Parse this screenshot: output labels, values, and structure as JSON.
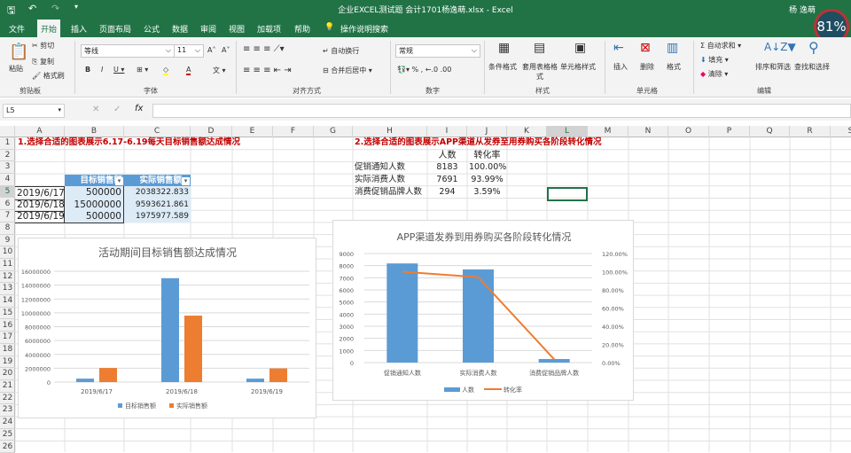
{
  "window": {
    "title": "企业EXCEL测试题 会计1701杨逸萌.xlsx - Excel",
    "user": "杨 逸萌",
    "badge": "81%"
  },
  "tabs": [
    "文件",
    "开始",
    "插入",
    "页面布局",
    "公式",
    "数据",
    "审阅",
    "视图",
    "加载项",
    "帮助",
    "操作说明搜索"
  ],
  "ribbon": {
    "clipboard": {
      "paste": "粘贴",
      "cut": "剪切",
      "copy": "复制",
      "painter": "格式刷",
      "group": "剪贴板"
    },
    "font": {
      "name": "等线",
      "size": "11",
      "group": "字体"
    },
    "align": {
      "wrap": "自动换行",
      "merge": "合并后居中",
      "group": "对齐方式"
    },
    "number": {
      "format": "常规",
      "group": "数字"
    },
    "styles": {
      "cond": "条件格式",
      "table": "套用表格格式",
      "cell": "单元格样式",
      "group": "样式"
    },
    "cells": {
      "insert": "插入",
      "delete": "删除",
      "format": "格式",
      "group": "单元格"
    },
    "editing": {
      "autosum": "自动求和",
      "fill": "填充",
      "clear": "清除",
      "sort": "排序和筛选",
      "find": "查找和选择",
      "group": "编辑"
    }
  },
  "formula_bar": {
    "name_box": "L5",
    "value": ""
  },
  "columns": [
    "A",
    "B",
    "C",
    "D",
    "E",
    "F",
    "G",
    "H",
    "I",
    "J",
    "K",
    "L",
    "M",
    "N",
    "O",
    "P",
    "Q",
    "R",
    "S"
  ],
  "sheet": {
    "task1": "1.选择合适的图表展示6.17-6.19每天目标销售额达成情况",
    "task2": "2.选择合适的图表展示APP渠道从发券至用券购买各阶段转化情况",
    "table1": {
      "headers": [
        "目标销售额",
        "实际销售额"
      ],
      "rows": [
        [
          "2019/6/17",
          "500000",
          "2038322.833"
        ],
        [
          "2019/6/18",
          "15000000",
          "9593621.861"
        ],
        [
          "2019/6/19",
          "500000",
          "1975977.589"
        ]
      ]
    },
    "table2": {
      "headers": [
        "人数",
        "转化率"
      ],
      "rows": [
        [
          "促销通知人数",
          "8183",
          "100.00%"
        ],
        [
          "实际消费人数",
          "7691",
          "93.99%"
        ],
        [
          "消费促销品牌人数",
          "294",
          "3.59%"
        ]
      ]
    }
  },
  "chart_data": [
    {
      "type": "bar",
      "title": "活动期间目标销售额达成情况",
      "categories": [
        "2019/6/17",
        "2019/6/18",
        "2019/6/19"
      ],
      "series": [
        {
          "name": "目标销售额",
          "values": [
            500000,
            15000000,
            500000
          ],
          "color": "#5b9bd5"
        },
        {
          "name": "实际销售额",
          "values": [
            2038322.833,
            9593621.861,
            1975977.589
          ],
          "color": "#ed7d31"
        }
      ],
      "ylim": [
        0,
        16000000
      ],
      "yticks": [
        "0",
        "2000000",
        "4000000",
        "6000000",
        "8000000",
        "10000000",
        "12000000",
        "14000000",
        "16000000"
      ],
      "legend": "bottom"
    },
    {
      "type": "bar+line",
      "title": "APP渠道发券到用券购买各阶段转化情况",
      "categories": [
        "促销通知人数",
        "实际消费人数",
        "消费促销品牌人数"
      ],
      "series": [
        {
          "name": "人数",
          "type": "bar",
          "values": [
            8183,
            7691,
            294
          ],
          "color": "#5b9bd5"
        },
        {
          "name": "转化率",
          "type": "line",
          "axis": "right",
          "values": [
            1.0,
            0.9399,
            0.0359
          ],
          "color": "#ed7d31"
        }
      ],
      "ylim": [
        0,
        9000
      ],
      "yticks": [
        "0",
        "1000",
        "2000",
        "3000",
        "4000",
        "5000",
        "6000",
        "7000",
        "8000",
        "9000"
      ],
      "y2lim": [
        0,
        1.2
      ],
      "y2ticks": [
        "0.00%",
        "20.00%",
        "40.00%",
        "60.00%",
        "80.00%",
        "100.00%",
        "120.00%"
      ],
      "legend": "bottom"
    }
  ]
}
